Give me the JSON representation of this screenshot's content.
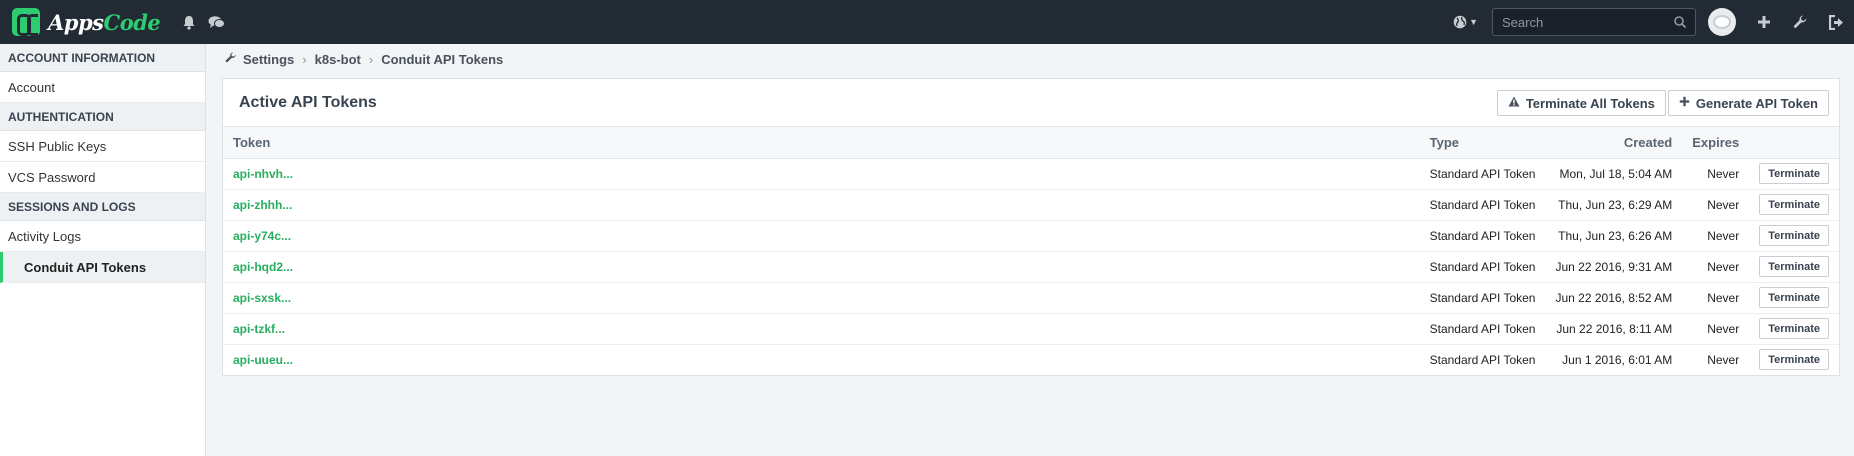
{
  "brand": {
    "apps": "Apps",
    "code": "Code"
  },
  "topbar": {
    "search_placeholder": "Search",
    "icons": [
      "bell-icon",
      "chat-icon",
      "globe-icon",
      "search-icon",
      "avatar",
      "plus-icon",
      "wrench-icon",
      "logout-icon"
    ]
  },
  "sidebar": {
    "sections": [
      {
        "header": "ACCOUNT INFORMATION",
        "items": [
          "Account"
        ]
      },
      {
        "header": "AUTHENTICATION",
        "items": [
          "SSH Public Keys",
          "VCS Password"
        ]
      },
      {
        "header": "SESSIONS AND LOGS",
        "items": [
          "Activity Logs",
          "Conduit API Tokens"
        ]
      }
    ],
    "active_item": "Conduit API Tokens"
  },
  "breadcrumb": [
    "Settings",
    "k8s-bot",
    "Conduit API Tokens"
  ],
  "panel": {
    "title": "Active API Tokens",
    "terminate_all_label": "Terminate All Tokens",
    "generate_label": "Generate API Token"
  },
  "table": {
    "columns": [
      "Token",
      "Type",
      "Created",
      "Expires"
    ],
    "rows": [
      {
        "token": "api-nhvh...",
        "type": "Standard API Token",
        "created": "Mon, Jul 18, 5:04 AM",
        "expires": "Never",
        "action": "Terminate"
      },
      {
        "token": "api-zhhh...",
        "type": "Standard API Token",
        "created": "Thu, Jun 23, 6:29 AM",
        "expires": "Never",
        "action": "Terminate"
      },
      {
        "token": "api-y74c...",
        "type": "Standard API Token",
        "created": "Thu, Jun 23, 6:26 AM",
        "expires": "Never",
        "action": "Terminate"
      },
      {
        "token": "api-hqd2...",
        "type": "Standard API Token",
        "created": "Jun 22 2016, 9:31 AM",
        "expires": "Never",
        "action": "Terminate"
      },
      {
        "token": "api-sxsk...",
        "type": "Standard API Token",
        "created": "Jun 22 2016, 8:52 AM",
        "expires": "Never",
        "action": "Terminate"
      },
      {
        "token": "api-tzkf...",
        "type": "Standard API Token",
        "created": "Jun 22 2016, 8:11 AM",
        "expires": "Never",
        "action": "Terminate"
      },
      {
        "token": "api-uueu...",
        "type": "Standard API Token",
        "created": "Jun 1 2016, 6:01 AM",
        "expires": "Never",
        "action": "Terminate"
      }
    ]
  },
  "colors": {
    "accent": "#2ecc71",
    "topbar": "#222a33",
    "token_link": "#27ae60"
  }
}
